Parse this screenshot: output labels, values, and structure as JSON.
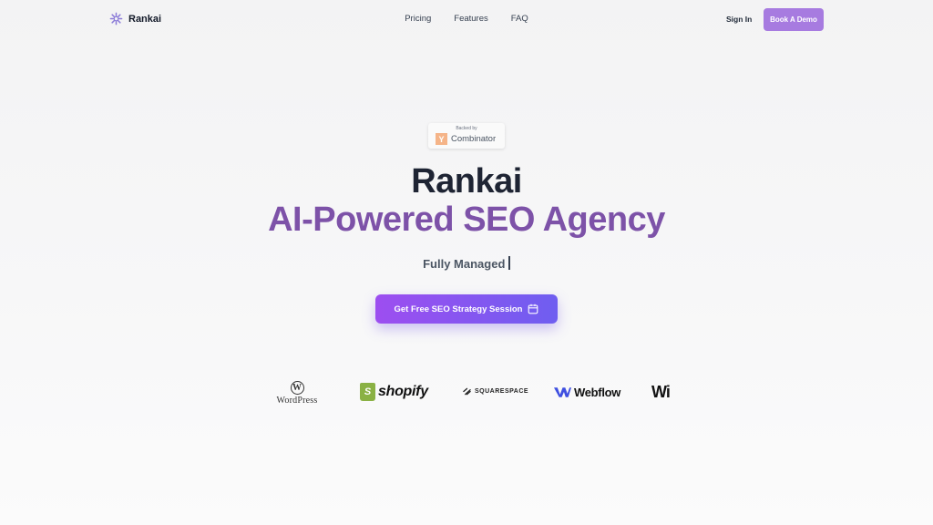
{
  "brand": {
    "name": "Rankai",
    "logo_icon": "rankai-logo-icon",
    "accent": "#a77be0"
  },
  "nav": {
    "links": [
      "Pricing",
      "Features",
      "FAQ"
    ],
    "sign_in": "Sign In",
    "demo": "Book A Demo"
  },
  "badge": {
    "backed": "Backed by",
    "mark": "Y",
    "name": "Combinator",
    "color": "#f5b488"
  },
  "hero": {
    "title": "Rankai",
    "subtitle": "AI-Powered SEO Agency",
    "subtitle_color": "#7d52a8",
    "tagline": "Fully Managed",
    "cta": "Get Free SEO Strategy Session",
    "cta_icon": "calendar-icon"
  },
  "logos": {
    "wordpress": {
      "mark": "W",
      "text": "WordPress"
    },
    "shopify": {
      "mark": "S",
      "text": "shopify"
    },
    "squarespace": {
      "text": "SQUARESPACE"
    },
    "webflow": {
      "text": "Webflow"
    },
    "wix": {
      "text": "Wi"
    }
  }
}
